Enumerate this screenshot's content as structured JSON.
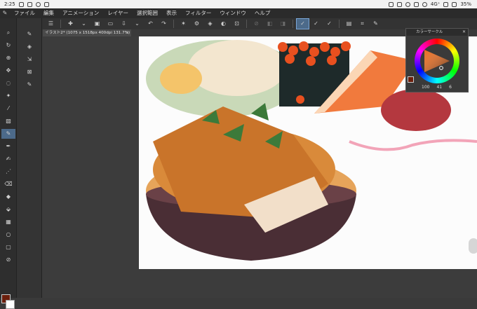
{
  "status_bar": {
    "time": "2:25",
    "network": "4G⁺",
    "battery": "35%"
  },
  "menu": {
    "items": [
      "ファイル",
      "編集",
      "アニメーション",
      "レイヤー",
      "選択範囲",
      "表示",
      "フィルター",
      "ウィンドウ",
      "ヘルプ"
    ]
  },
  "document_tab": {
    "label": "イラスト2* (1075 x 1518px 400dpi 131.7%)",
    "close": "×"
  },
  "color_panel": {
    "title": "カラーサークル",
    "h": "100",
    "s": "41",
    "v": "6"
  },
  "colors": {
    "foreground": "#6b1e0c",
    "background": "#ffffff",
    "accent": "#4c6a8a"
  },
  "icons": {
    "tools": [
      "zoom-icon",
      "rotate-icon",
      "move-icon",
      "operation-icon",
      "lasso-icon",
      "wand-icon",
      "eyedropper-icon",
      "pen-icon",
      "pencil-icon",
      "brush-icon",
      "airbrush-icon",
      "decoration-icon",
      "eraser-icon",
      "blend-icon",
      "fill-icon",
      "gradient-icon",
      "figure-icon",
      "frame-icon",
      "text-icon"
    ],
    "command": [
      "menu-icon",
      "new-canvas-icon",
      "open-icon",
      "save-icon",
      "export-icon",
      "undo-icon",
      "redo-icon",
      "transform-icon",
      "settings-icon",
      "clear-icon",
      "fill-selection-icon",
      "select-all-icon",
      "deselect-icon",
      "crop-icon",
      "invert-icon",
      "brush-size-icon",
      "opacity-icon",
      "stabilizer-icon",
      "layer-icon",
      "ruler-icon",
      "edit-icon"
    ]
  }
}
